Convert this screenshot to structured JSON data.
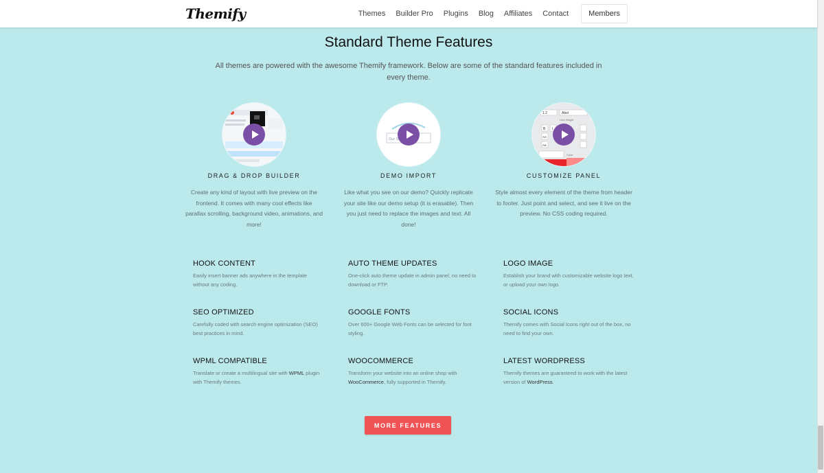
{
  "header": {
    "logo": "Themify",
    "nav": [
      "Themes",
      "Builder Pro",
      "Plugins",
      "Blog",
      "Affiliates",
      "Contact"
    ],
    "members_label": "Members"
  },
  "section": {
    "title": "Standard Theme Features",
    "subtitle": "All themes are powered with the awesome Themify framework. Below are some of the standard features included in every theme."
  },
  "features": [
    {
      "title": "DRAG & DROP BUILDER",
      "desc": "Create any kind of layout with live preview on the frontend. It comes with many cool effects like parallax scrolling, background video, animations, and more!",
      "icon": "play-icon"
    },
    {
      "title": "DEMO IMPORT",
      "desc": "Like what you see on our demo? Quickly replicate your site like our demo setup (it is erasable). Then you just need to replace the images and text. All done!",
      "icon": "play-icon",
      "thumb_text": "Our Sec... Ser..."
    },
    {
      "title": "CUSTOMIZE PANEL",
      "desc": "Style almost every element of the theme from header to footer. Just point and select, and see it live on the preview. No CSS coding required.",
      "icon": "play-icon",
      "thumb_text": [
        "1.2",
        "Abel",
        "Line Height",
        "B",
        "I",
        "AA",
        "Aa",
        "Color"
      ]
    }
  ],
  "items": [
    {
      "title": "HOOK CONTENT",
      "desc": "Easily insert banner ads anywhere in the template without any coding."
    },
    {
      "title": "AUTO THEME UPDATES",
      "desc": "One-click auto theme update in admin panel, no need to download or FTP."
    },
    {
      "title": "LOGO IMAGE",
      "desc": "Establish your brand with customizable website logo text, or upload your own logo."
    },
    {
      "title": "SEO OPTIMIZED",
      "desc": "Carefully coded with search engine optimization (SEO) best practices in mind."
    },
    {
      "title": "GOOGLE FONTS",
      "desc": "Over 600+ Google Web Fonts can be selected for font styling."
    },
    {
      "title": "SOCIAL ICONS",
      "desc": "Themify comes with Social Icons right out of the box, no need to find your own."
    },
    {
      "title": "WPML COMPATIBLE",
      "desc_pre": "Translate or create a multilingual site with ",
      "desc_link": "WPML",
      "desc_post": " plugin with Themify themes."
    },
    {
      "title": "WOOCOMMERCE",
      "desc_pre": "Transform your website into an online shop with ",
      "desc_link": "WooCommerce",
      "desc_post": ", fully supported in Themify."
    },
    {
      "title": "LATEST WORDPRESS",
      "desc_pre": "Themify themes are guaranteed to work with the latest version of ",
      "desc_link": "WordPress",
      "desc_post": "."
    }
  ],
  "more_button": "MORE FEATURES",
  "colors": {
    "background": "#bce9ec",
    "accent_button": "#f05355",
    "play_button": "#7b4fa6"
  }
}
